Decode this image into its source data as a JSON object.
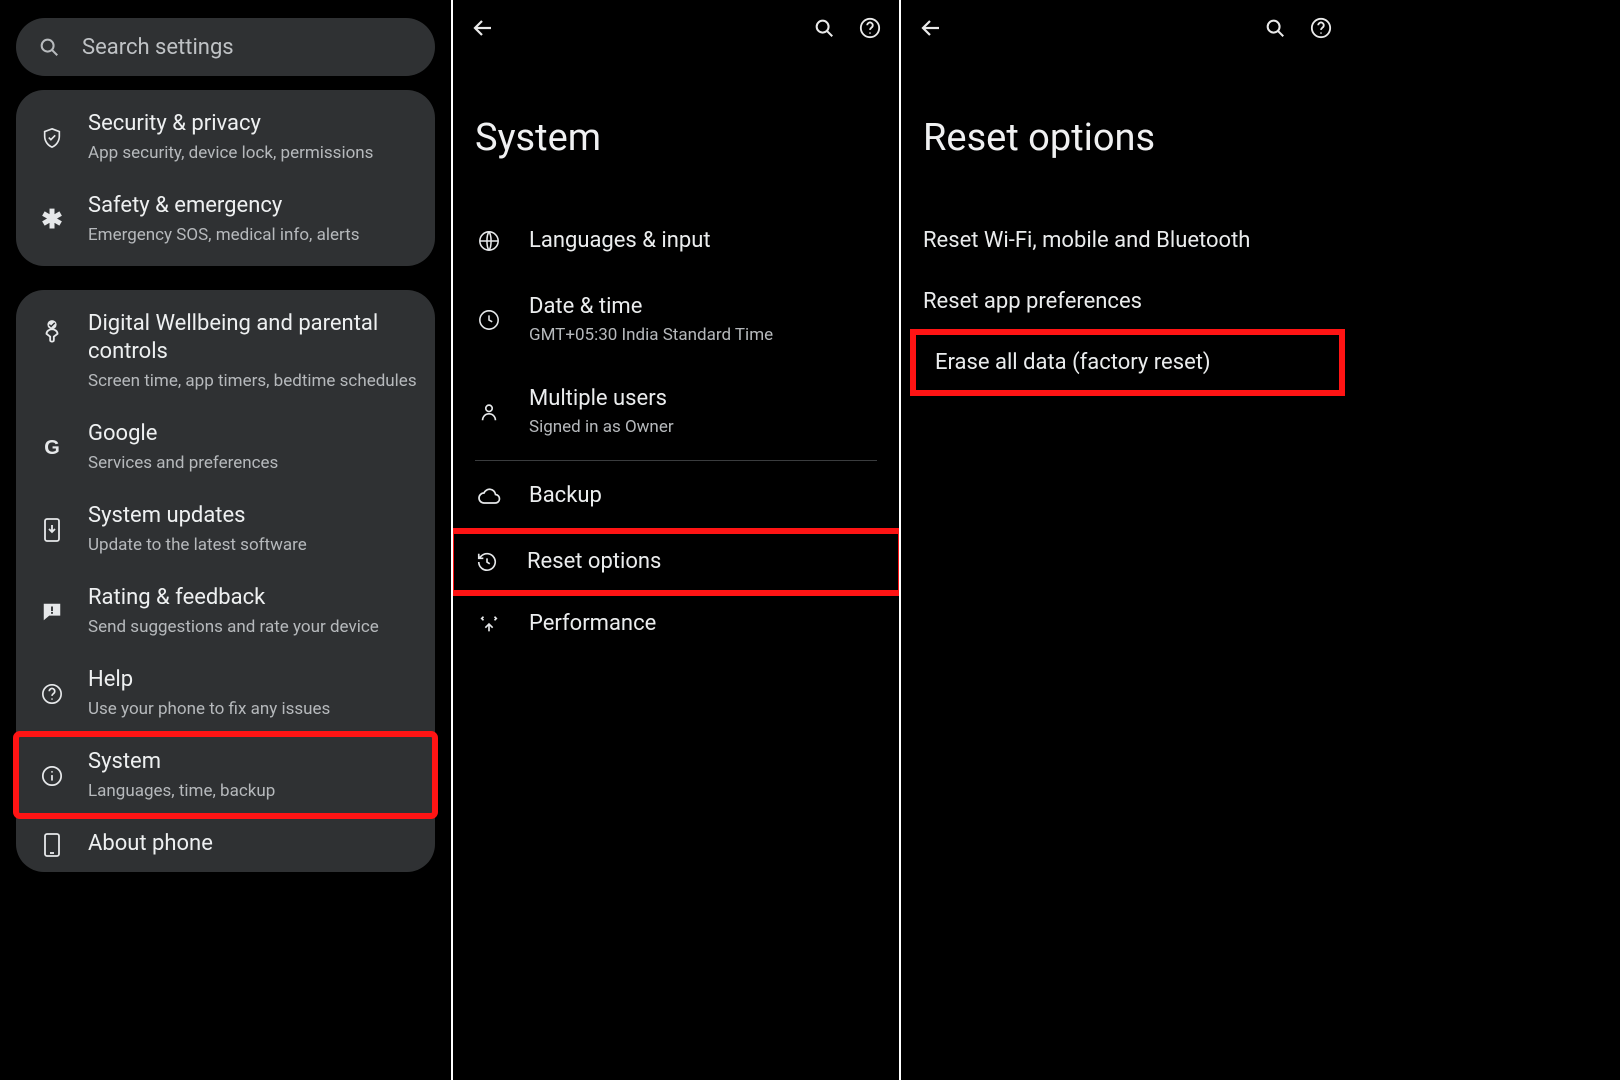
{
  "pane1": {
    "search_placeholder": "Search settings",
    "group1": [
      {
        "icon": "shield-check-icon",
        "title": "Security & privacy",
        "sub": "App security, device lock, permissions"
      },
      {
        "icon": "asterisk-icon",
        "title": "Safety & emergency",
        "sub": "Emergency SOS, medical info, alerts"
      }
    ],
    "group2": [
      {
        "icon": "wellbeing-icon",
        "title": "Digital Wellbeing and parental controls",
        "sub": "Screen time, app timers, bedtime schedules"
      },
      {
        "icon": "google-icon",
        "title": "Google",
        "sub": "Services and preferences"
      },
      {
        "icon": "system-update-icon",
        "title": "System updates",
        "sub": "Update to the latest software"
      },
      {
        "icon": "feedback-icon",
        "title": "Rating & feedback",
        "sub": "Send suggestions and rate your device"
      },
      {
        "icon": "help-icon",
        "title": "Help",
        "sub": "Use your phone to fix any issues"
      },
      {
        "icon": "info-icon",
        "title": "System",
        "sub": "Languages, time, backup",
        "highlighted": true
      },
      {
        "icon": "phone-icon",
        "title": "About phone",
        "sub": ""
      }
    ]
  },
  "pane2": {
    "page_title": "System",
    "items": [
      {
        "icon": "globe-icon",
        "title": "Languages & input",
        "sub": ""
      },
      {
        "icon": "clock-icon",
        "title": "Date & time",
        "sub": "GMT+05:30 India Standard Time"
      },
      {
        "icon": "user-icon",
        "title": "Multiple users",
        "sub": "Signed in as Owner"
      }
    ],
    "items_after_divider": [
      {
        "icon": "cloud-icon",
        "title": "Backup",
        "sub": ""
      },
      {
        "icon": "reset-icon",
        "title": "Reset options",
        "sub": "",
        "highlighted": true
      },
      {
        "icon": "performance-icon",
        "title": "Performance",
        "sub": ""
      }
    ]
  },
  "pane3": {
    "page_title": "Reset options",
    "options": [
      {
        "label": "Reset Wi-Fi, mobile and Bluetooth"
      },
      {
        "label": "Reset app preferences"
      },
      {
        "label": "Erase all data (factory reset)",
        "highlighted": true
      }
    ]
  }
}
